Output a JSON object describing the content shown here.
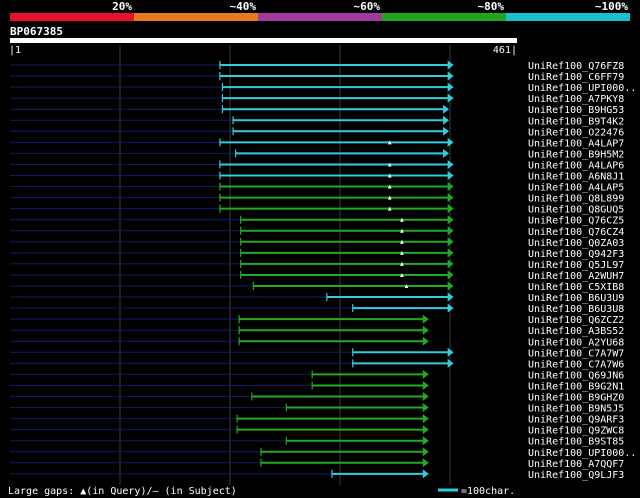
{
  "header": {
    "pct_labels": [
      "20%",
      "~40%",
      "~60%",
      "~80%",
      "~100%"
    ],
    "band_colors": [
      "#e8102a",
      "#e87a1e",
      "#9e3aa0",
      "#1fa51f",
      "#19bfcc"
    ]
  },
  "query": {
    "id": "BP067385",
    "start_label": "|1",
    "end_label": "461|"
  },
  "hits": [
    {
      "name": "UniRef100_Q76FZ8",
      "start": 0.414,
      "end": 0.875,
      "color": "cyan",
      "arrow": "right",
      "mark": null
    },
    {
      "name": "UniRef100_C6FF79",
      "start": 0.414,
      "end": 0.875,
      "color": "cyan",
      "arrow": "right",
      "mark": null
    },
    {
      "name": "UniRef100_UPI000..",
      "start": 0.419,
      "end": 0.875,
      "color": "cyan",
      "arrow": "right",
      "mark": null
    },
    {
      "name": "UniRef100_A7PKY8",
      "start": 0.419,
      "end": 0.875,
      "color": "cyan",
      "arrow": "right",
      "mark": null
    },
    {
      "name": "UniRef100_B9HG53",
      "start": 0.419,
      "end": 0.866,
      "color": "cyan",
      "arrow": "right",
      "mark": null
    },
    {
      "name": "UniRef100_B9T4K2",
      "start": 0.44,
      "end": 0.866,
      "color": "cyan",
      "arrow": "right",
      "mark": null
    },
    {
      "name": "UniRef100_O22476",
      "start": 0.44,
      "end": 0.866,
      "color": "cyan",
      "arrow": "right",
      "mark": null
    },
    {
      "name": "UniRef100_A4LAP7",
      "start": 0.414,
      "end": 0.875,
      "color": "cyan",
      "arrow": "right",
      "mark": 0.749
    },
    {
      "name": "UniRef100_B9H5M2",
      "start": 0.445,
      "end": 0.866,
      "color": "cyan",
      "arrow": "right",
      "mark": null
    },
    {
      "name": "UniRef100_A4LAP6",
      "start": 0.414,
      "end": 0.875,
      "color": "cyan",
      "arrow": "right",
      "mark": 0.749
    },
    {
      "name": "UniRef100_A6N8J1",
      "start": 0.414,
      "end": 0.875,
      "color": "cyan",
      "arrow": "right",
      "mark": 0.749
    },
    {
      "name": "UniRef100_A4LAP5",
      "start": 0.414,
      "end": 0.875,
      "color": "green",
      "arrow": "right",
      "mark": 0.749
    },
    {
      "name": "UniRef100_Q8L899",
      "start": 0.414,
      "end": 0.875,
      "color": "green",
      "arrow": "right",
      "mark": 0.749
    },
    {
      "name": "UniRef100_Q8GUQ5",
      "start": 0.414,
      "end": 0.875,
      "color": "green",
      "arrow": "right",
      "mark": 0.749
    },
    {
      "name": "UniRef100_Q76CZ5",
      "start": 0.455,
      "end": 0.875,
      "color": "green",
      "arrow": "right",
      "mark": 0.773
    },
    {
      "name": "UniRef100_Q76CZ4",
      "start": 0.455,
      "end": 0.875,
      "color": "green",
      "arrow": "right",
      "mark": 0.773
    },
    {
      "name": "UniRef100_Q0ZA03",
      "start": 0.455,
      "end": 0.875,
      "color": "green",
      "arrow": "right",
      "mark": 0.773
    },
    {
      "name": "UniRef100_Q942F3",
      "start": 0.455,
      "end": 0.875,
      "color": "green",
      "arrow": "right",
      "mark": 0.773
    },
    {
      "name": "UniRef100_Q5JL97",
      "start": 0.455,
      "end": 0.875,
      "color": "green",
      "arrow": "right",
      "mark": 0.773
    },
    {
      "name": "UniRef100_A2WUH7",
      "start": 0.455,
      "end": 0.875,
      "color": "green",
      "arrow": "right",
      "mark": 0.773
    },
    {
      "name": "UniRef100_C5XIB8",
      "start": 0.48,
      "end": 0.875,
      "color": "green",
      "arrow": "right",
      "mark": 0.782
    },
    {
      "name": "UniRef100_B6U3U9",
      "start": 0.625,
      "end": 0.875,
      "color": "cyan",
      "arrow": "right",
      "mark": null
    },
    {
      "name": "UniRef100_B6U3U8",
      "start": 0.676,
      "end": 0.875,
      "color": "cyan",
      "arrow": "right",
      "mark": null
    },
    {
      "name": "UniRef100_Q6ZCZ2",
      "start": 0.452,
      "end": 0.826,
      "color": "green",
      "arrow": "right",
      "mark": null
    },
    {
      "name": "UniRef100_A3BS52",
      "start": 0.452,
      "end": 0.826,
      "color": "green",
      "arrow": "right",
      "mark": null
    },
    {
      "name": "UniRef100_A2YU68",
      "start": 0.452,
      "end": 0.826,
      "color": "green",
      "arrow": "right",
      "mark": null
    },
    {
      "name": "UniRef100_C7A7W7",
      "start": 0.676,
      "end": 0.875,
      "color": "cyan",
      "arrow": "right",
      "mark": null
    },
    {
      "name": "UniRef100_C7A7W6",
      "start": 0.676,
      "end": 0.875,
      "color": "cyan",
      "arrow": "right",
      "mark": null
    },
    {
      "name": "UniRef100_Q69JN6",
      "start": 0.596,
      "end": 0.826,
      "color": "green",
      "arrow": "right",
      "mark": null
    },
    {
      "name": "UniRef100_B9G2N1",
      "start": 0.596,
      "end": 0.826,
      "color": "green",
      "arrow": "right",
      "mark": null
    },
    {
      "name": "UniRef100_B9GHZ0",
      "start": 0.477,
      "end": 0.826,
      "color": "green",
      "arrow": "right",
      "mark": null
    },
    {
      "name": "UniRef100_B9N5J5",
      "start": 0.545,
      "end": 0.826,
      "color": "green",
      "arrow": "right",
      "mark": null
    },
    {
      "name": "UniRef100_Q9ARF3",
      "start": 0.448,
      "end": 0.826,
      "color": "green",
      "arrow": "right",
      "mark": null
    },
    {
      "name": "UniRef100_Q9ZWC8",
      "start": 0.448,
      "end": 0.826,
      "color": "green",
      "arrow": "right",
      "mark": null
    },
    {
      "name": "UniRef100_B9ST85",
      "start": 0.545,
      "end": 0.826,
      "color": "green",
      "arrow": "right",
      "mark": null
    },
    {
      "name": "UniRef100_UPI000..",
      "start": 0.495,
      "end": 0.826,
      "color": "green",
      "arrow": "right",
      "mark": null
    },
    {
      "name": "UniRef100_A7QQF7",
      "start": 0.495,
      "end": 0.826,
      "color": "green",
      "arrow": "right",
      "mark": null
    },
    {
      "name": "UniRef100_Q9LJF3",
      "start": 0.635,
      "end": 0.826,
      "color": "cyan",
      "arrow": "right",
      "mark": null
    }
  ],
  "legend": {
    "gaps_text": "Large gaps: ▲(in Query)/— (in Subject)",
    "scale_text": "=100char."
  },
  "colors": {
    "background": "#000000",
    "gridline": "#3c3c3c",
    "context_line": "#0c1a6e",
    "cyan": "#33ccdd",
    "green": "#22aa22",
    "text": "#ffffff"
  }
}
